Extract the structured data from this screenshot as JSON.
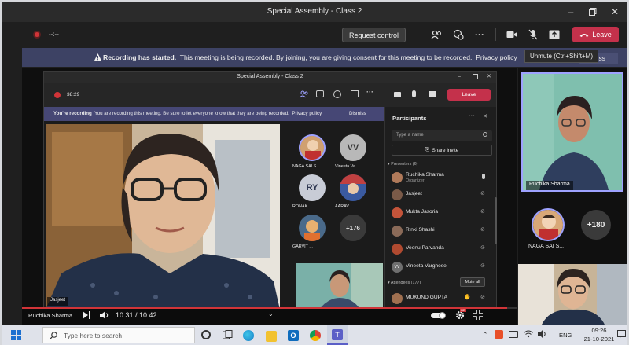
{
  "window": {
    "title": "Special Assembly - Class 2"
  },
  "toolbar": {
    "timer": "--:--",
    "request_control": "Request control",
    "leave": "Leave"
  },
  "banner": {
    "heading": "Recording has started.",
    "message": "This meeting is being recorded. By joining, you are giving consent for this meeting to be recorded.",
    "link": "Privacy policy",
    "dismiss": "Dismiss"
  },
  "tooltip": "Unmute (Ctrl+Shift+M)",
  "inner": {
    "title": "Special Assembly - Class 2",
    "timer": "38:29",
    "leave": "Leave",
    "banner_heading": "You're recording",
    "banner_message": "You are recording this meeting. Be sure to let everyone know that they are being recorded.",
    "banner_link": "Privacy policy",
    "dismiss": "Dismiss",
    "main_name": "Jasjeet",
    "tiles": [
      {
        "name": "NAGA SAI S...",
        "initials": ""
      },
      {
        "name": "Vineeta Va...",
        "initials": "VV"
      },
      {
        "name": "RONAK ...",
        "initials": "RY"
      },
      {
        "name": "AARAV ...",
        "initials": ""
      },
      {
        "name": "GARVIT ...",
        "initials": ""
      },
      {
        "name": "",
        "initials": "+176"
      }
    ]
  },
  "participants": {
    "title": "Participants",
    "search_placeholder": "Type a name",
    "share_invite": "Share invite",
    "presenters_header": "Presenters (6)",
    "attendees_header": "Attendees (177)",
    "mute_all": "Mute all",
    "list": [
      {
        "name": "Ruchika Sharma",
        "role": "Organizer",
        "color": "#b07a5a"
      },
      {
        "name": "Jasjeet",
        "role": "",
        "color": "#7a5a48"
      },
      {
        "name": "Mukta Jasoria",
        "role": "",
        "color": "#c4543a"
      },
      {
        "name": "Rinki Shashi",
        "role": "",
        "color": "#8a6a58"
      },
      {
        "name": "Veenu Parvanda",
        "role": "",
        "color": "#b04a30"
      },
      {
        "name": "Vineeta Varghese",
        "role": "",
        "color": "#6f6f6f",
        "initials": "VV"
      }
    ],
    "attendee": {
      "name": "MUKUND GUPTA",
      "color": "#a07050"
    }
  },
  "right": {
    "top_name": "Ruchika Sharma",
    "tile_name": "NAGA SAI S...",
    "more": "+180"
  },
  "player": {
    "name": "Ruchika Sharma",
    "time": "10:31 / 10:42",
    "progress": 0.98
  },
  "taskbar": {
    "search_placeholder": "Type here to search",
    "lang": "ENG",
    "time": "09:26",
    "date": "21-10-2021"
  },
  "colors": {
    "leave": "#c4314b",
    "banner": "#3d4264",
    "accent": "#6264a7"
  }
}
